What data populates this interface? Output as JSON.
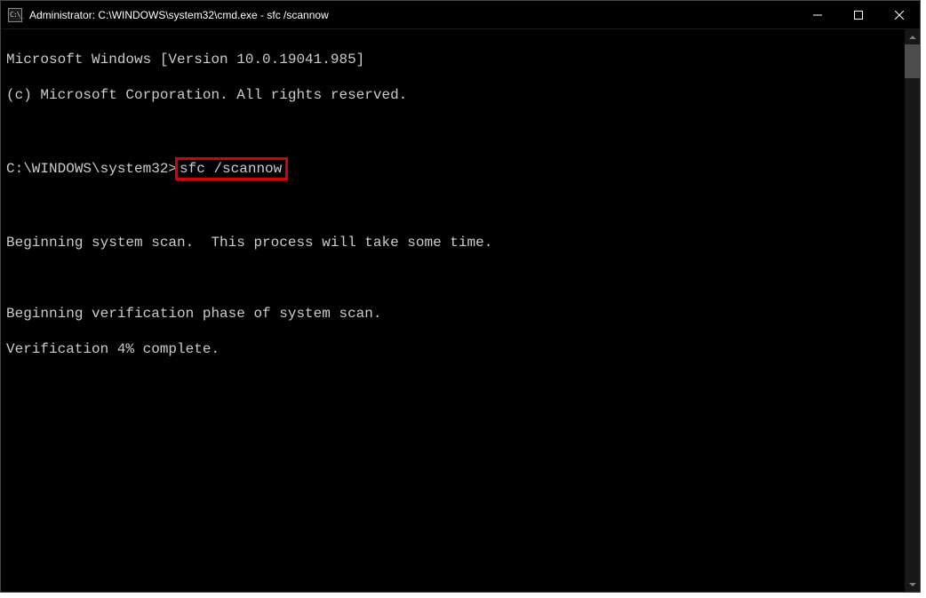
{
  "window": {
    "title": "Administrator: C:\\WINDOWS\\system32\\cmd.exe - sfc  /scannow"
  },
  "terminal": {
    "line_version": "Microsoft Windows [Version 10.0.19041.985]",
    "line_copyright": "(c) Microsoft Corporation. All rights reserved.",
    "prompt_path": "C:\\WINDOWS\\system32>",
    "command": "sfc /scannow",
    "line_begin_scan": "Beginning system scan.  This process will take some time.",
    "line_verif_phase": "Beginning verification phase of system scan.",
    "line_verif_pct": "Verification 4% complete."
  }
}
